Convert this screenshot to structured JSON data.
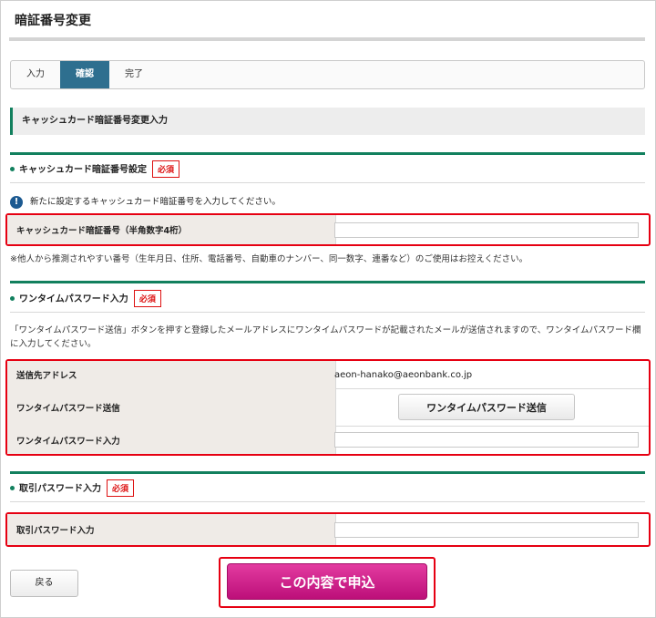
{
  "page_title": "暗証番号変更",
  "steps": [
    "入力",
    "確認",
    "完了"
  ],
  "active_step": 1,
  "section_title": "キャッシュカード暗証番号変更入力",
  "pin_section": {
    "heading": "キャッシュカード暗証番号設定",
    "required": "必須",
    "notice": "新たに設定するキャッシュカード暗証番号を入力してください。",
    "field_label": "キャッシュカード暗証番号（半角数字4桁）",
    "field_value": "",
    "note": "※他人から推測されやすい番号（生年月日、住所、電話番号、自動車のナンバー、同一数字、連番など）のご使用はお控えください。"
  },
  "otp_section": {
    "heading": "ワンタイムパスワード入力",
    "required": "必須",
    "description": "「ワンタイムパスワード送信」ボタンを押すと登録したメールアドレスにワンタイムパスワードが記載されたメールが送信されますので、ワンタイムパスワード欄に入力してください。",
    "address_label": "送信先アドレス",
    "address_value": "aeon-hanako@aeonbank.co.jp",
    "send_label": "ワンタイムパスワード送信",
    "send_button": "ワンタイムパスワード送信",
    "input_label": "ワンタイムパスワード入力",
    "input_value": ""
  },
  "trade_section": {
    "heading": "取引パスワード入力",
    "required": "必須",
    "input_label": "取引パスワード入力",
    "input_value": ""
  },
  "buttons": {
    "back": "戻る",
    "submit": "この内容で申込"
  },
  "icons": {
    "notice": "exclamation-circle-icon",
    "bullet": "green-dot-icon"
  },
  "colors": {
    "accent_green": "#12805e",
    "step_active": "#2e6f8f",
    "required_red": "#dd1111",
    "highlight_red": "#e60012",
    "submit_magenta": "#c9188a"
  }
}
